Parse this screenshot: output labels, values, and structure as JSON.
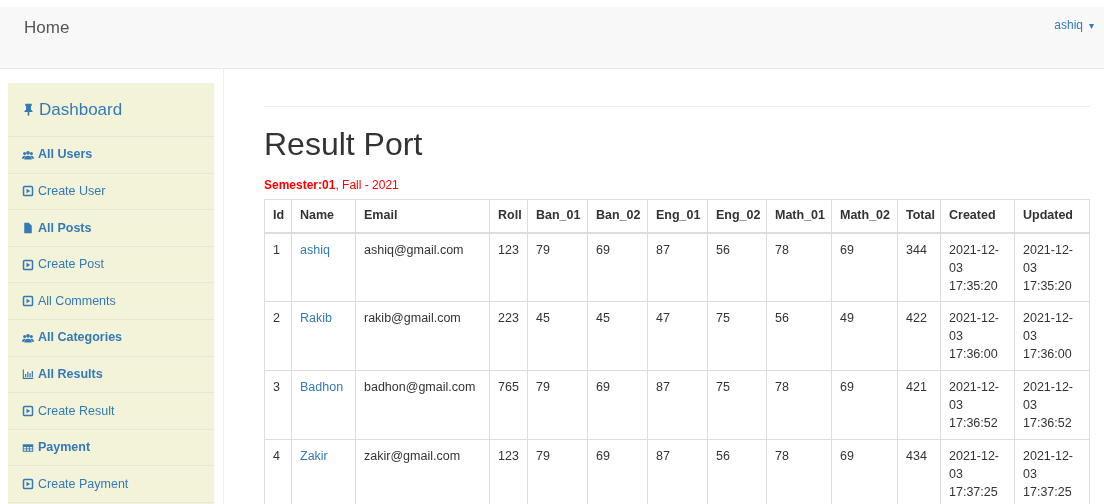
{
  "navbar": {
    "brand": "Home",
    "user": "ashiq",
    "user_caret": "▾"
  },
  "sidebar": {
    "items": [
      {
        "kind": "title",
        "label": "Dashboard"
      },
      {
        "kind": "section",
        "label": "All Users"
      },
      {
        "kind": "link",
        "label": "Create User"
      },
      {
        "kind": "section",
        "label": "All Posts"
      },
      {
        "kind": "link",
        "label": "Create Post"
      },
      {
        "kind": "link",
        "label": "All Comments"
      },
      {
        "kind": "section",
        "label": "All Categories"
      },
      {
        "kind": "section",
        "label": "All Results"
      },
      {
        "kind": "link",
        "label": "Create Result"
      },
      {
        "kind": "section",
        "label": "Payment"
      },
      {
        "kind": "link",
        "label": "Create Payment"
      }
    ]
  },
  "page": {
    "title": "Result Port",
    "subtitle": "**Semester:01**, Fall - 2021"
  },
  "table": {
    "columns": [
      "Id",
      "Name",
      "Email",
      "Roll",
      "Ban_01",
      "Ban_02",
      "Eng_01",
      "Eng_02",
      "Math_01",
      "Math_02",
      "Total",
      "Created",
      "Updated"
    ],
    "rows": [
      [
        "1",
        "ashiq",
        "ashiq@gmail.com",
        "123",
        "79",
        "69",
        "87",
        "56",
        "78",
        "69",
        "344",
        "2021-12-03 17:35:20",
        "2021-12-03 17:35:20"
      ],
      [
        "2",
        "Rakib",
        "rakib@gmail.com",
        "223",
        "45",
        "45",
        "47",
        "75",
        "56",
        "49",
        "422",
        "2021-12-03 17:36:00",
        "2021-12-03 17:36:00"
      ],
      [
        "3",
        "Badhon",
        "badhon@gmail.com",
        "765",
        "79",
        "69",
        "87",
        "75",
        "78",
        "69",
        "421",
        "2021-12-03 17:36:52",
        "2021-12-03 17:36:52"
      ],
      [
        "4",
        "Zakir",
        "zakir@gmail.com",
        "123",
        "79",
        "69",
        "87",
        "56",
        "78",
        "69",
        "434",
        "2021-12-03 17:37:25",
        "2021-12-03 17:37:25"
      ]
    ]
  }
}
